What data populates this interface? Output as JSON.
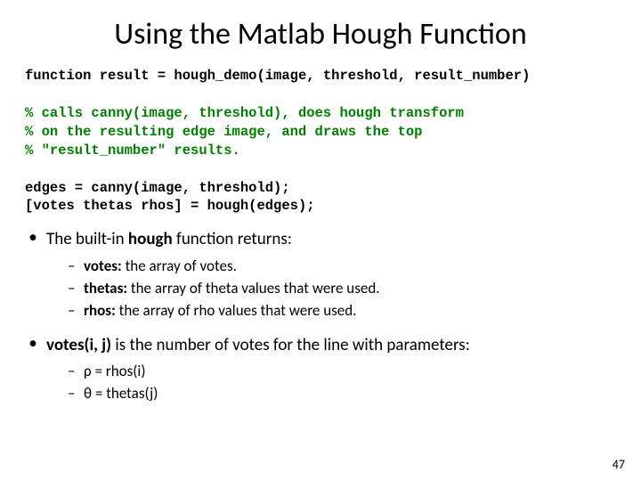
{
  "title": "Using the Matlab Hough Function",
  "code": {
    "sig": "function result = hough_demo(image, threshold, result_number)",
    "c1": "% calls canny(image, threshold), does hough transform",
    "c2": "% on the resulting edge image, and draws the top",
    "c3": "% \"result_number\" results.",
    "l1": "edges = canny(image, threshold);",
    "l2": "[votes thetas rhos] = hough(edges);"
  },
  "b1": {
    "pre": "The built-in ",
    "bold": "hough",
    "post": " function returns:",
    "s1": {
      "bold": "votes:",
      "rest": " the array of votes."
    },
    "s2": {
      "bold": "thetas:",
      "rest": " the array of theta values that were used."
    },
    "s3": {
      "bold": "rhos:",
      "rest": " the array of rho values that were used."
    }
  },
  "b2": {
    "bold": "votes(i, j)",
    "post": " is the number of votes for the line with parameters:",
    "s1": "ρ = rhos(i)",
    "s2": "θ = thetas(j)"
  },
  "pagenum": "47"
}
